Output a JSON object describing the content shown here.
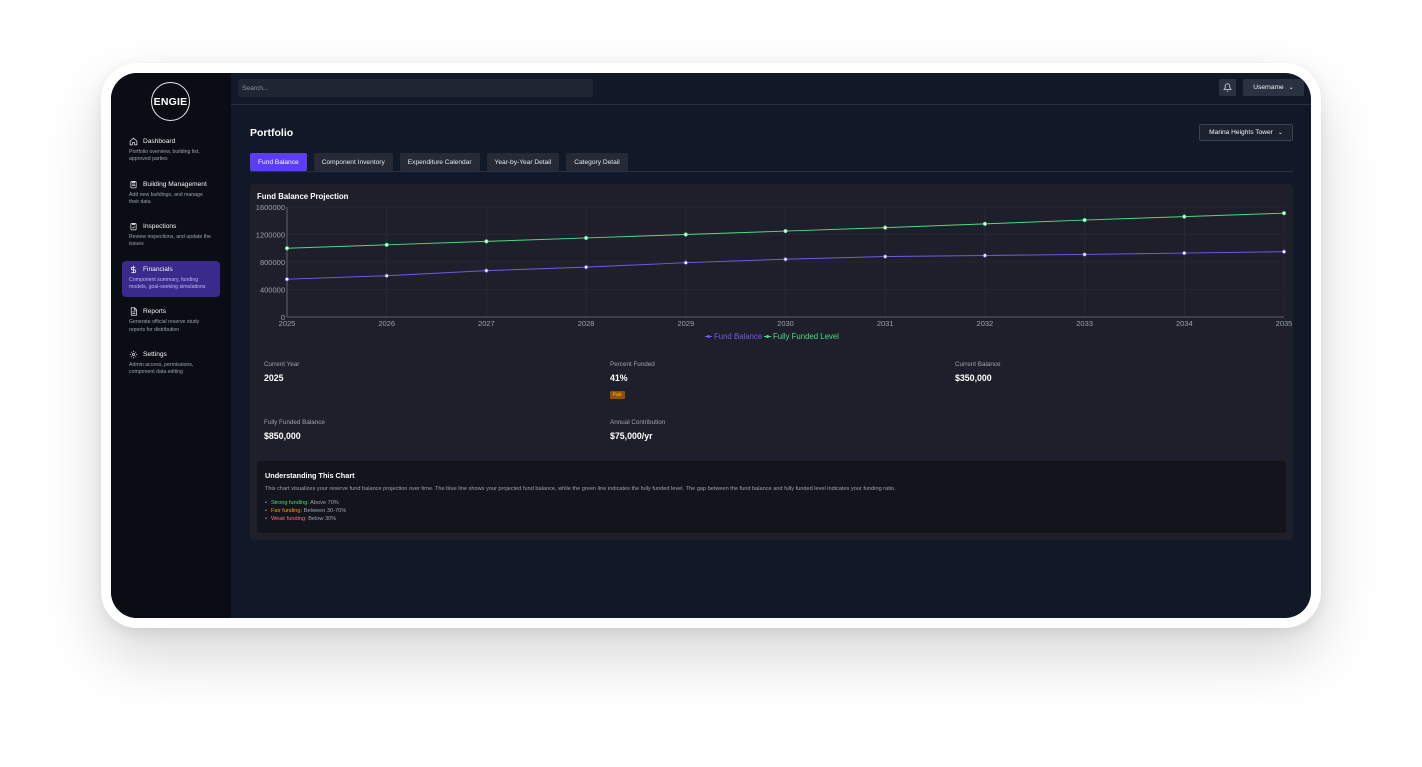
{
  "sidebar": {
    "logo": "ENGIE",
    "items": [
      {
        "label": "Dashboard",
        "desc": "Portfolio overview, building list, approved parties",
        "icon": "home-icon"
      },
      {
        "label": "Building Management",
        "desc": "Add new buildings, and manage their data",
        "icon": "clipboard-icon"
      },
      {
        "label": "Inspections",
        "desc": "Review inspections, and update the issues",
        "icon": "clipboard-check-icon"
      },
      {
        "label": "Financials",
        "desc": "Component summary, funding models, goal-seeking simulations",
        "icon": "dollar-icon",
        "active": true
      },
      {
        "label": "Reports",
        "desc": "Generate official reserve study reports for distribution",
        "icon": "document-icon"
      },
      {
        "label": "Settings",
        "desc": "Admin access, permissions, component data editing",
        "icon": "gear-icon"
      }
    ]
  },
  "topbar": {
    "search_placeholder": "Search...",
    "username": "Username"
  },
  "page": {
    "title": "Portfolio",
    "building": "Marina Heights Tower"
  },
  "tabs": [
    "Fund Balance",
    "Component Inventory",
    "Expenditure Calendar",
    "Year-by-Year Detail",
    "Category Detail"
  ],
  "card": {
    "title": "Fund Balance Projection"
  },
  "colors": {
    "accent": "#5b3df5",
    "fund_line": "#6d5ce8",
    "funded_line": "#4ade80",
    "fair": "#f59e0b",
    "strong": "#4ade80",
    "weak": "#f87171"
  },
  "chart_data": {
    "type": "line",
    "x": [
      2025,
      2026,
      2027,
      2028,
      2029,
      2030,
      2031,
      2032,
      2033,
      2034,
      2035
    ],
    "yticks": [
      "0",
      "400000",
      "800000",
      "1200000",
      "1600000"
    ],
    "ylim": [
      0,
      1600000
    ],
    "series": [
      {
        "name": "Fund Balance",
        "color": "#6d5ce8",
        "values": [
          550000,
          600000,
          675000,
          725000,
          790000,
          840000,
          880000,
          895000,
          910000,
          930000,
          950000
        ]
      },
      {
        "name": "Fully Funded Level",
        "color": "#4ade80",
        "values": [
          1000000,
          1050000,
          1100000,
          1150000,
          1200000,
          1250000,
          1300000,
          1355000,
          1410000,
          1460000,
          1510000
        ]
      }
    ],
    "grid": true,
    "legend": "bottom"
  },
  "stats": {
    "current_year_label": "Current Year",
    "current_year": "2025",
    "percent_label": "Percent Funded",
    "percent": "41%",
    "percent_badge": "Fair",
    "balance_label": "Current Balance",
    "balance": "$350,000",
    "ffb_label": "Fully Funded Balance",
    "ffb": "$850,000",
    "contrib_label": "Annual Contribution",
    "contrib": "$75,000/yr"
  },
  "info": {
    "title": "Understanding This Chart",
    "text": "This chart visualizes your reserve fund balance projection over time. The blue line shows your projected fund balance, while the green line indicates the fully funded level. The gap between the fund balance and fully funded level indicates your funding ratio.",
    "strong_label": "Strong funding:",
    "strong_text": "Above 70%",
    "fair_label": "Fair funding:",
    "fair_text": "Between 30-70%",
    "weak_label": "Weak funding:",
    "weak_text": "Below 30%"
  }
}
